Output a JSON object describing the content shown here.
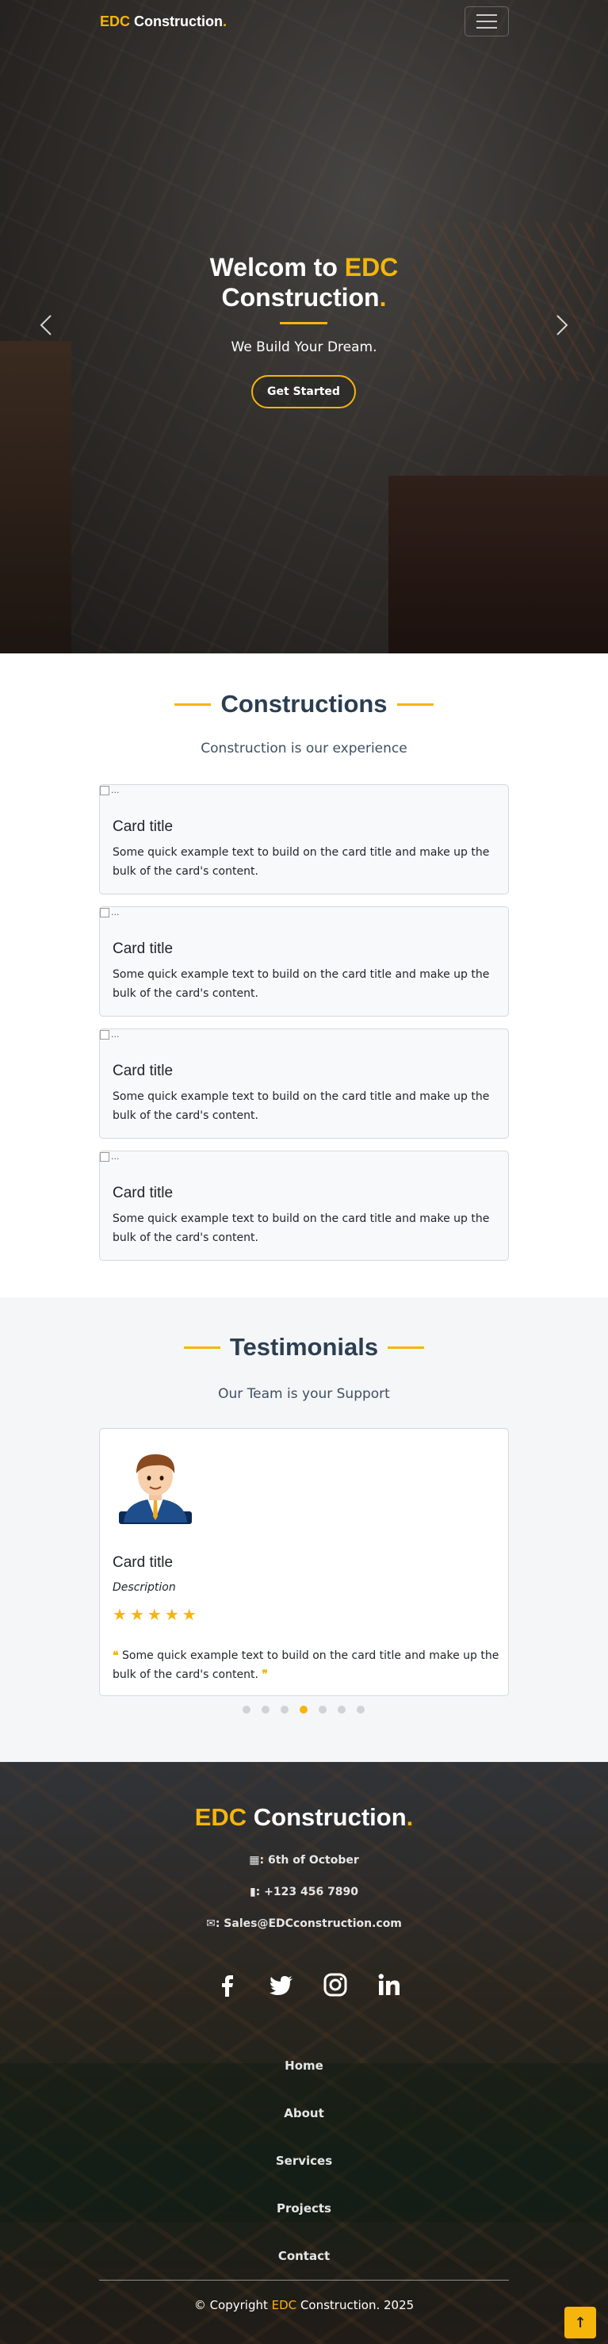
{
  "nav": {
    "brand_a": "EDC",
    "brand_b": " Construction",
    "brand_dot": "."
  },
  "hero": {
    "title_a": "Welcom to ",
    "title_b": "EDC",
    "title_c": "Construction",
    "title_dot": ".",
    "subtitle": "We Build Your Dream.",
    "cta": "Get Started"
  },
  "constructions": {
    "title": "Constructions",
    "subtitle": "Construction is our experience",
    "cards": [
      {
        "img_alt": "...",
        "title": "Card title",
        "text": "Some quick example text to build on the card title and make up the bulk of the card's content."
      },
      {
        "img_alt": "...",
        "title": "Card title",
        "text": "Some quick example text to build on the card title and make up the bulk of the card's content."
      },
      {
        "img_alt": "...",
        "title": "Card title",
        "text": "Some quick example text to build on the card title and make up the bulk of the card's content."
      },
      {
        "img_alt": "...",
        "title": "Card title",
        "text": "Some quick example text to build on the card title and make up the bulk of the card's content."
      }
    ]
  },
  "testimonials": {
    "title": "Testimonials",
    "subtitle": "Our Team is your Support",
    "card": {
      "title": "Card title",
      "description": "Description",
      "rating": 5,
      "quote": " Some quick example text to build on the card title and make up the bulk of the card's content. "
    },
    "slides": 7,
    "active_slide": 4
  },
  "footer": {
    "brand_a": "EDC",
    "brand_b": " Construction",
    "brand_dot": ".",
    "address": ": 6th of October",
    "phone": ": +123 456 7890",
    "email": ": Sales@EDCconstruction.com",
    "social": [
      "facebook-icon",
      "twitter-icon",
      "instagram-icon",
      "linkedin-icon"
    ],
    "links": [
      "Home",
      "About",
      "Services",
      "Projects",
      "Contact"
    ],
    "copyright_a": "© Copyright ",
    "copyright_b": "EDC",
    "copyright_c": " Construction. 2025"
  },
  "colors": {
    "accent": "#f5b50a",
    "heading": "#2c3e50"
  }
}
